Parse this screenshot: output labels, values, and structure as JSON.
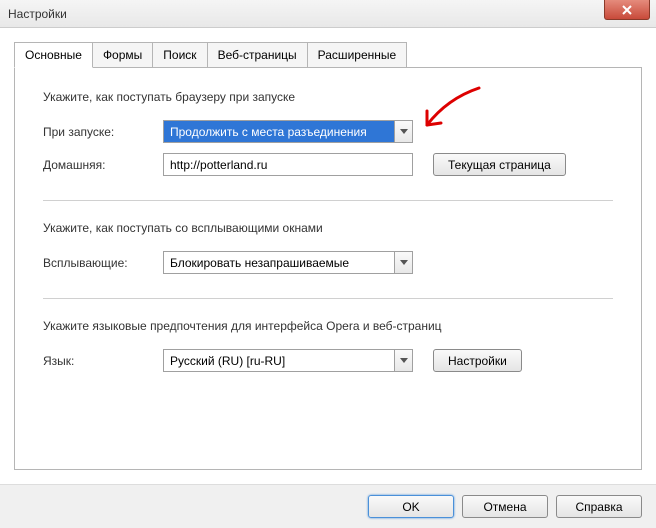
{
  "window": {
    "title": "Настройки"
  },
  "tabs": [
    {
      "label": "Основные",
      "active": true
    },
    {
      "label": "Формы",
      "active": false
    },
    {
      "label": "Поиск",
      "active": false
    },
    {
      "label": "Веб-страницы",
      "active": false
    },
    {
      "label": "Расширенные",
      "active": false
    }
  ],
  "sections": {
    "startup": {
      "heading": "Укажите, как поступать браузеру при запуске",
      "on_start_label": "При запуске:",
      "on_start_value": "Продолжить с места разъединения",
      "home_label": "Домашняя:",
      "home_value": "http://potterland.ru",
      "current_page_btn": "Текущая страница"
    },
    "popups": {
      "heading": "Укажите, как поступать со всплывающими окнами",
      "popups_label": "Всплывающие:",
      "popups_value": "Блокировать незапрашиваемые"
    },
    "language": {
      "heading": "Укажите языковые предпочтения для интерфейса Opera и веб-страниц",
      "lang_label": "Язык:",
      "lang_value": "Русский (RU) [ru-RU]",
      "settings_btn": "Настройки"
    }
  },
  "footer": {
    "ok": "OK",
    "cancel": "Отмена",
    "help": "Справка"
  }
}
